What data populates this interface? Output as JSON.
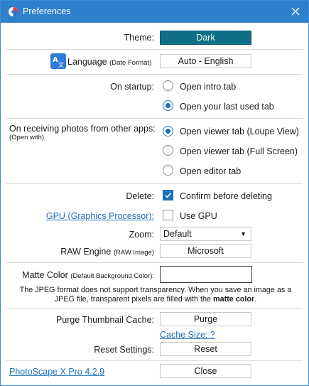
{
  "window": {
    "title": "Preferences"
  },
  "theme": {
    "label": "Theme:",
    "value": "Dark"
  },
  "language": {
    "label": "Language",
    "sublabel": "(Date Format)",
    "value": "Auto - English"
  },
  "startup": {
    "label": "On startup:",
    "options": [
      "Open intro tab",
      "Open your last used tab"
    ],
    "selected_index": 1
  },
  "receiving": {
    "label": "On receiving photos from other apps:",
    "sublabel": "(Open with)",
    "options": [
      "Open viewer tab (Loupe View)",
      "Open viewer tab (Full Screen)",
      "Open editor tab"
    ],
    "selected_index": 0
  },
  "delete": {
    "label": "Delete:",
    "option": "Confirm before deleting",
    "checked": true
  },
  "gpu": {
    "link": "GPU (Graphics Processor):",
    "option": "Use GPU",
    "checked": false
  },
  "zoom": {
    "label": "Zoom:",
    "value": "Default"
  },
  "raw": {
    "label": "RAW Engine",
    "sublabel": "(RAW Image)",
    "value": "Microsoft"
  },
  "matte": {
    "label": "Matte Color",
    "sublabel": "(Default Background Color):",
    "color": "#ffffff",
    "note_part1": "The JPEG format does not support transparency. When you save an image as a JPEG file, transparent pixels are filled with the ",
    "note_bold": "matte color",
    "note_end": "."
  },
  "purge": {
    "label": "Purge Thumbnail Cache:",
    "button": "Purge",
    "cache_link": "Cache Size: ?"
  },
  "reset": {
    "label": "Reset Settings:",
    "button": "Reset"
  },
  "footer": {
    "version_link": "PhotoScape X Pro 4.2.9",
    "close_button": "Close"
  },
  "colors": {
    "titlebar": "#2e7fcd",
    "accent": "#1e6fb8",
    "theme_button": "#0f6f86"
  }
}
